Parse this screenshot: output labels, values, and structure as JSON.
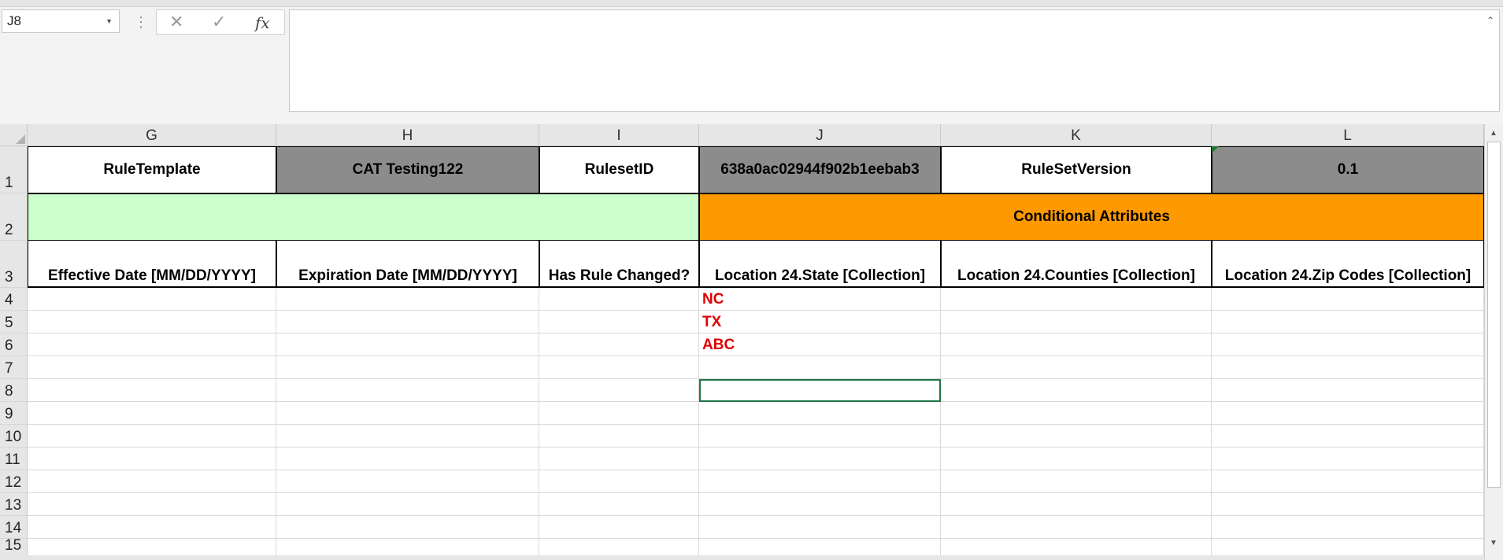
{
  "formula_bar": {
    "name_box": "J8",
    "cancel_icon": "✕",
    "enter_icon": "✓",
    "fx_label": "fx",
    "formula": ""
  },
  "columns": [
    "G",
    "H",
    "I",
    "J",
    "K",
    "L"
  ],
  "rows": [
    "1",
    "2",
    "3",
    "4",
    "5",
    "6",
    "7",
    "8",
    "9",
    "10",
    "11",
    "12",
    "13",
    "14",
    "15"
  ],
  "row1": {
    "g": "RuleTemplate",
    "h": "CAT Testing122",
    "i": "RulesetID",
    "j": "638a0ac02944f902b1eebab3",
    "k": "RuleSetVersion",
    "l": "0.1"
  },
  "row2": {
    "conditional": "Conditional Attributes"
  },
  "row3": {
    "g": "Effective Date [MM/DD/YYYY]",
    "h": "Expiration Date [MM/DD/YYYY]",
    "i": "Has Rule Changed?",
    "j": "Location 24.State [Collection]",
    "k": "Location 24.Counties [Collection]",
    "l": "Location 24.Zip Codes [Collection]"
  },
  "data": {
    "j4": "NC",
    "j5": "TX",
    "j6": "ABC"
  },
  "colors": {
    "green_band": "#ccffcc",
    "orange_band": "#ff9900",
    "gray_fill": "#8c8c8c",
    "red_text": "#e00000"
  }
}
